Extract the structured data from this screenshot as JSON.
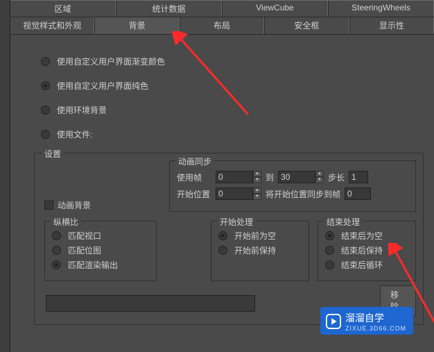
{
  "tabs_top": {
    "region": "区域",
    "stats": "统计数据",
    "viewcube": "ViewCube",
    "steering": "SteeringWheels"
  },
  "tabs_bottom": {
    "visual": "视觉样式和外观",
    "background": "背景",
    "layout": "布局",
    "safe": "安全框",
    "display": "显示性"
  },
  "radios": {
    "gradient": "使用自定义用户界面渐变颜色",
    "solid": "使用自定义用户界面纯色",
    "env": "使用环境背景",
    "file": "使用文件:"
  },
  "settings_legend": "设置",
  "anim_bg": "动画背景",
  "sync": {
    "legend": "动画同步",
    "use_frame": "使用帧",
    "start_pos": "开始位置",
    "to": "到",
    "step": "步长",
    "sync_to_frame": "将开始位置同步到帧",
    "v0": "0",
    "v30": "30",
    "v1": "1",
    "vpos": "0",
    "vframe": "0"
  },
  "aspect": {
    "legend": "纵横比",
    "viewport": "匹配视口",
    "bitmap": "匹配位图",
    "render": "匹配渲染输出"
  },
  "start": {
    "legend": "开始处理",
    "blank": "开始前为空",
    "hold": "开始前保持"
  },
  "end": {
    "legend": "结束处理",
    "blank": "结束后为空",
    "hold": "结束后保持",
    "loop": "结束后循环"
  },
  "remove_btn": "移除",
  "watermark": {
    "text": "溜溜自学",
    "sub": "ZIXUE.3D66.COM"
  }
}
